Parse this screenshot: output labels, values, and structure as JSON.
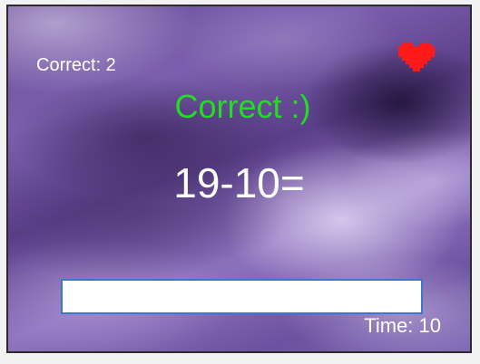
{
  "score": {
    "correct_text": "Correct: 2"
  },
  "lives": {
    "icon": "heart-icon",
    "color": "#ff1a1a",
    "count": 1
  },
  "feedback": {
    "text": "Correct :)",
    "color": "#22dd22"
  },
  "problem": {
    "text": "19-10="
  },
  "answer": {
    "value": "",
    "placeholder": ""
  },
  "timer": {
    "text": "Time: 10"
  },
  "theme": {
    "background": "purple clouds",
    "text_color": "#ffffff",
    "input_border": "#3a78c9"
  }
}
